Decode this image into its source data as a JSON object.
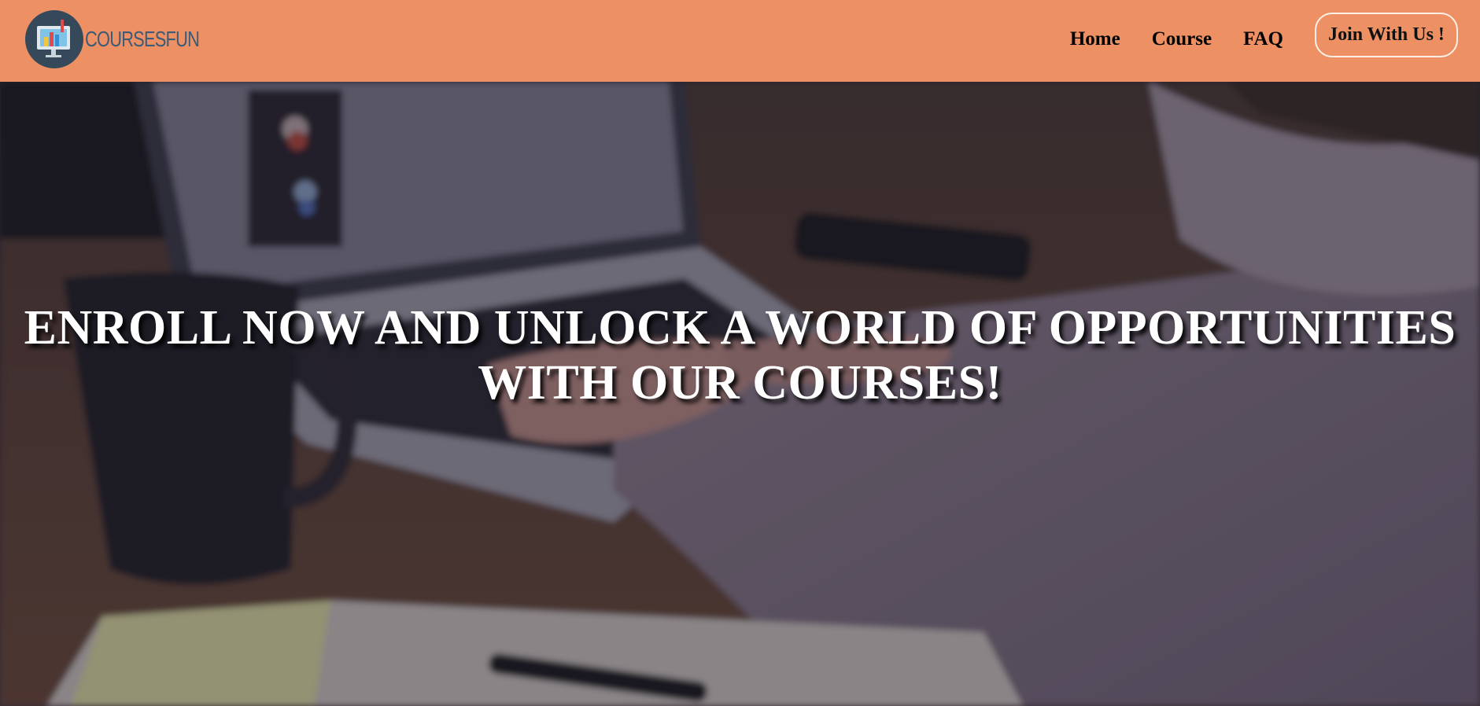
{
  "brand": {
    "logo_text": "COURSESFUN",
    "nav_bg_color": "#ed9063"
  },
  "nav": {
    "links": [
      {
        "label": "Home"
      },
      {
        "label": "Course"
      },
      {
        "label": "FAQ"
      }
    ],
    "cta_label": "Join With Us !"
  },
  "hero": {
    "heading_line1": "ENROLL NOW AND UNLOCK A WORLD OF OPPORTUNITIES",
    "heading_line2": "WITH OUR COURSES!",
    "background_image": "person typing on a laptop at a desk with a mug and notebook"
  }
}
